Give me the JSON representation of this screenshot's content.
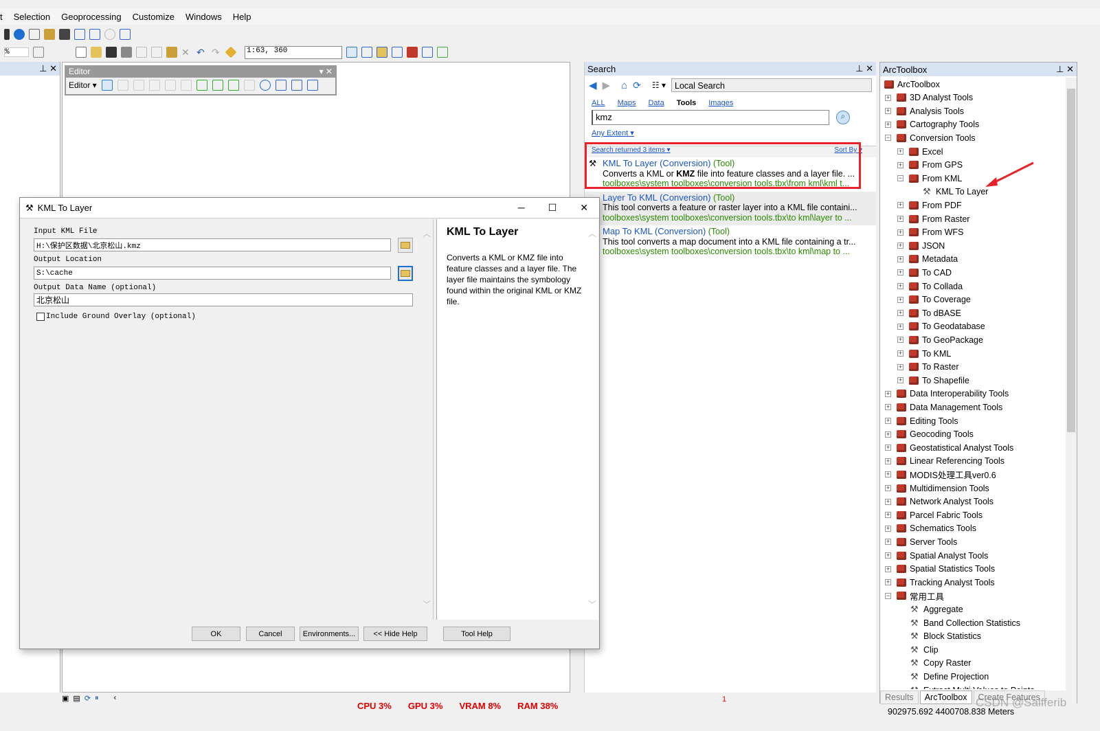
{
  "menu": [
    "t",
    "Selection",
    "Geoprocessing",
    "Customize",
    "Windows",
    "Help"
  ],
  "toolbar": {
    "scale": "1:63, 360",
    "zoom_pct": "%"
  },
  "editor": {
    "title": "Editor",
    "menu": "Editor ▾"
  },
  "search": {
    "title": "Search",
    "scope": "Local Search",
    "tabs": [
      "ALL",
      "Maps",
      "Data",
      "Tools",
      "Images"
    ],
    "active_tab": "Tools",
    "query": "kmz",
    "extent": "Any Extent ▾",
    "returned": "Search returned 3 items ▾",
    "sort": "Sort By ▾",
    "results": [
      {
        "title": "KML To Layer (Conversion)",
        "kind": "(Tool)",
        "desc_pre": "Converts a KML or ",
        "desc_bold": "KMZ",
        "desc_post": " file into feature classes and a layer file. ...",
        "path": "toolboxes\\system toolboxes\\conversion tools.tbx\\from kml\\kml t..."
      },
      {
        "title": "Layer To KML (Conversion)",
        "kind": "(Tool)",
        "desc_pre": "This tool converts a feature or raster layer into a KML file containi...",
        "desc_bold": "",
        "desc_post": "",
        "path": "toolboxes\\system toolboxes\\conversion tools.tbx\\to kml\\layer to ..."
      },
      {
        "title": "Map To KML (Conversion)",
        "kind": "(Tool)",
        "desc_pre": "This tool converts a map document into a KML file containing a tr...",
        "desc_bold": "",
        "desc_post": "",
        "path": "toolboxes\\system toolboxes\\conversion tools.tbx\\to kml\\map to ..."
      }
    ],
    "page": "1"
  },
  "toolbox": {
    "title": "ArcToolbox",
    "tabs": [
      "Results",
      "ArcToolbox",
      "Create Features"
    ],
    "items": [
      {
        "l": 0,
        "t": "ArcToolbox",
        "e": ""
      },
      {
        "l": 1,
        "t": "3D Analyst Tools",
        "e": "+"
      },
      {
        "l": 1,
        "t": "Analysis Tools",
        "e": "+"
      },
      {
        "l": 1,
        "t": "Cartography Tools",
        "e": "+"
      },
      {
        "l": 1,
        "t": "Conversion Tools",
        "e": "-"
      },
      {
        "l": 2,
        "t": "Excel",
        "e": "+"
      },
      {
        "l": 2,
        "t": "From GPS",
        "e": "+"
      },
      {
        "l": 2,
        "t": "From KML",
        "e": "-"
      },
      {
        "l": 3,
        "t": "KML To Layer",
        "e": ""
      },
      {
        "l": 2,
        "t": "From PDF",
        "e": "+"
      },
      {
        "l": 2,
        "t": "From Raster",
        "e": "+"
      },
      {
        "l": 2,
        "t": "From WFS",
        "e": "+"
      },
      {
        "l": 2,
        "t": "JSON",
        "e": "+"
      },
      {
        "l": 2,
        "t": "Metadata",
        "e": "+"
      },
      {
        "l": 2,
        "t": "To CAD",
        "e": "+"
      },
      {
        "l": 2,
        "t": "To Collada",
        "e": "+"
      },
      {
        "l": 2,
        "t": "To Coverage",
        "e": "+"
      },
      {
        "l": 2,
        "t": "To dBASE",
        "e": "+"
      },
      {
        "l": 2,
        "t": "To Geodatabase",
        "e": "+"
      },
      {
        "l": 2,
        "t": "To GeoPackage",
        "e": "+"
      },
      {
        "l": 2,
        "t": "To KML",
        "e": "+"
      },
      {
        "l": 2,
        "t": "To Raster",
        "e": "+"
      },
      {
        "l": 2,
        "t": "To Shapefile",
        "e": "+"
      },
      {
        "l": 1,
        "t": "Data Interoperability Tools",
        "e": "+"
      },
      {
        "l": 1,
        "t": "Data Management Tools",
        "e": "+"
      },
      {
        "l": 1,
        "t": "Editing Tools",
        "e": "+"
      },
      {
        "l": 1,
        "t": "Geocoding Tools",
        "e": "+"
      },
      {
        "l": 1,
        "t": "Geostatistical Analyst Tools",
        "e": "+"
      },
      {
        "l": 1,
        "t": "Linear Referencing Tools",
        "e": "+"
      },
      {
        "l": 1,
        "t": "MODIS处理工具ver0.6",
        "e": "+"
      },
      {
        "l": 1,
        "t": "Multidimension Tools",
        "e": "+"
      },
      {
        "l": 1,
        "t": "Network Analyst Tools",
        "e": "+"
      },
      {
        "l": 1,
        "t": "Parcel Fabric Tools",
        "e": "+"
      },
      {
        "l": 1,
        "t": "Schematics Tools",
        "e": "+"
      },
      {
        "l": 1,
        "t": "Server Tools",
        "e": "+"
      },
      {
        "l": 1,
        "t": "Spatial Analyst Tools",
        "e": "+"
      },
      {
        "l": 1,
        "t": "Spatial Statistics Tools",
        "e": "+"
      },
      {
        "l": 1,
        "t": "Tracking Analyst Tools",
        "e": "+"
      },
      {
        "l": 1,
        "t": "常用工具",
        "e": "-"
      },
      {
        "l": 2.5,
        "t": "Aggregate",
        "e": ""
      },
      {
        "l": 2.5,
        "t": "Band Collection Statistics",
        "e": ""
      },
      {
        "l": 2.5,
        "t": "Block Statistics",
        "e": ""
      },
      {
        "l": 2.5,
        "t": "Clip",
        "e": ""
      },
      {
        "l": 2.5,
        "t": "Copy Raster",
        "e": ""
      },
      {
        "l": 2.5,
        "t": "Define Projection",
        "e": ""
      },
      {
        "l": 2.5,
        "t": "Extract Multi Values to Points",
        "e": ""
      }
    ]
  },
  "dialog": {
    "title": "KML To Layer",
    "input_label": "Input KML File",
    "input_value": "H:\\保护区数据\\北京松山.kmz",
    "output_label": "Output Location",
    "output_value": "S:\\cache",
    "name_label": "Output Data Name (optional)",
    "name_value": "北京松山",
    "overlay_label": "Include Ground Overlay (optional)",
    "overlay_checked": false,
    "help_title": "KML To Layer",
    "help_text": "Converts a KML or KMZ file into feature classes and a layer file. The layer file maintains the symbology found within the original KML or KMZ file.",
    "buttons": [
      "OK",
      "Cancel",
      "Environments...",
      "<< Hide Help",
      "Tool Help"
    ]
  },
  "status": {
    "cpu": "CPU   3%",
    "gpu": "GPU   3%",
    "vram": "VRAM   8%",
    "ram": "RAM  38%",
    "coords": "902975.692  4400708.838 Meters"
  },
  "watermark": "CSDN @Salfferib",
  "colors": {
    "highlight": "#e8222a",
    "link": "#1a55c8",
    "path": "#2a8a00"
  }
}
